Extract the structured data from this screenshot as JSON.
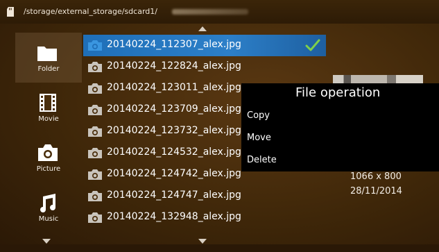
{
  "header": {
    "path": "/storage/external_storage/sdcard1/",
    "icon": "sd-card-icon"
  },
  "sidebar": {
    "items": [
      {
        "label": "Folder",
        "icon": "folder-icon",
        "active": true
      },
      {
        "label": "Movie",
        "icon": "film-icon",
        "active": false
      },
      {
        "label": "Picture",
        "icon": "camera-icon",
        "active": false
      },
      {
        "label": "Music",
        "icon": "music-note-icon",
        "active": false
      }
    ]
  },
  "files": [
    {
      "name": "20140224_112307_alex.jpg",
      "selected": true
    },
    {
      "name": "20140224_122824_alex.jpg",
      "selected": false
    },
    {
      "name": "20140224_123011_alex.jpg",
      "selected": false
    },
    {
      "name": "20140224_123709_alex.jpg",
      "selected": false
    },
    {
      "name": "20140224_123732_alex.jpg",
      "selected": false
    },
    {
      "name": "20140224_124532_alex.jpg",
      "selected": false
    },
    {
      "name": "20140224_124742_alex.jpg",
      "selected": false
    },
    {
      "name": "20140224_124747_alex.jpg",
      "selected": false
    },
    {
      "name": "20140224_132948_alex.jpg",
      "selected": false
    }
  ],
  "popup": {
    "title": "File operation",
    "items": [
      "Copy",
      "Move",
      "Delete"
    ]
  },
  "info": {
    "resolution": "1066 x 800",
    "date": "28/11/2014"
  },
  "colors": {
    "selection": "#2c7fc8",
    "check": "#7fd04a",
    "background": "#3f2709"
  }
}
